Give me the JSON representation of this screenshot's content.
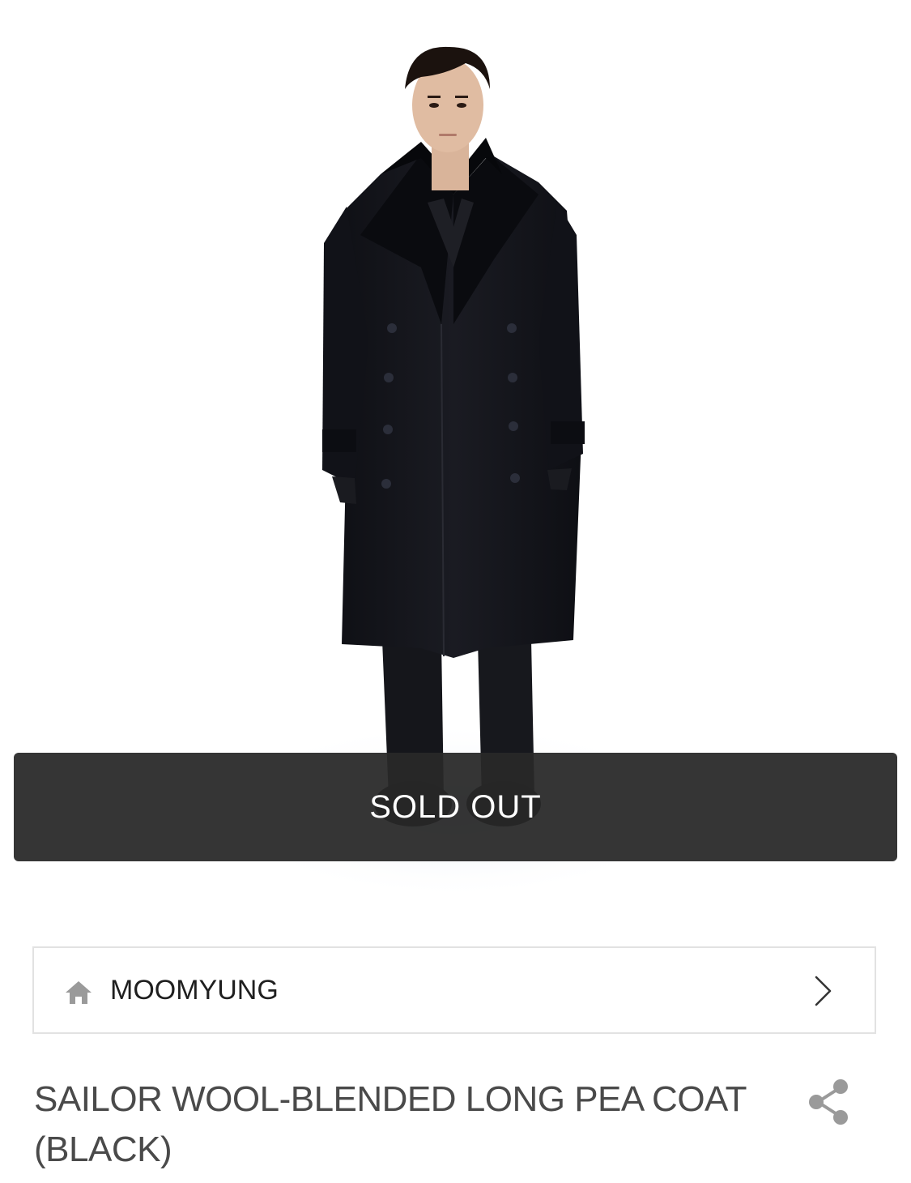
{
  "product": {
    "image_alt": "Model wearing black long double-breasted pea coat",
    "sold_out_label": "SOLD OUT",
    "title": "SAILOR WOOL-BLENDED LONG PEA COAT(BLACK)"
  },
  "brand": {
    "name": "MOOMYUNG",
    "icon": "home-icon",
    "chevron_icon": "chevron-right-icon"
  },
  "actions": {
    "share_icon": "share-icon"
  },
  "colors": {
    "sold_out_bg": "#282828",
    "border": "#e2e2e2",
    "title_text": "#4a4a4a",
    "icon_gray": "#9a9a9a"
  }
}
